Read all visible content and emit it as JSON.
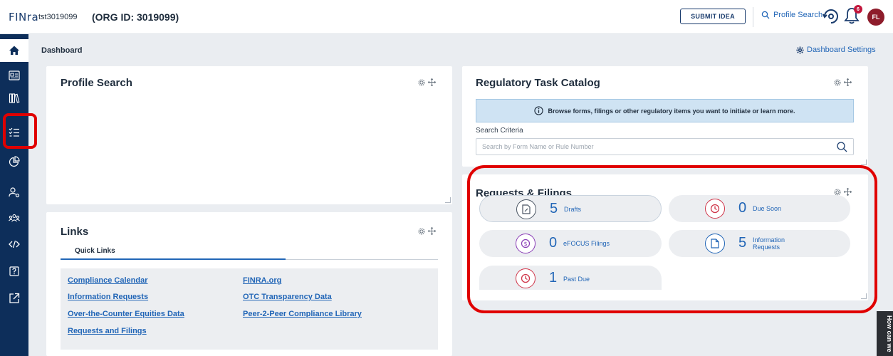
{
  "header": {
    "brand": "FINra",
    "user_id": "tst3019099",
    "org_label": "(ORG ID: 3019099)",
    "submit_idea_label": "SUBMIT IDEA",
    "profile_search_label": "Profile Search",
    "notification_count": "6",
    "avatar_initials": "FL"
  },
  "sidebar": {
    "items": [
      {
        "icon": "home-icon",
        "active": true
      },
      {
        "icon": "id-card-icon"
      },
      {
        "icon": "library-icon"
      },
      {
        "icon": "checklist-icon",
        "highlighted": true
      },
      {
        "icon": "pie-chart-icon"
      },
      {
        "icon": "user-settings-icon"
      },
      {
        "icon": "group-icon"
      },
      {
        "icon": "code-icon"
      },
      {
        "icon": "help-icon"
      },
      {
        "icon": "external-link-icon"
      }
    ]
  },
  "dashboard": {
    "title": "Dashboard",
    "settings_label": "Dashboard Settings"
  },
  "profile_search_panel": {
    "title": "Profile Search"
  },
  "links_panel": {
    "title": "Links",
    "tab_label": "Quick Links",
    "links": [
      "Compliance Calendar",
      "Information Requests",
      "Over-the-Counter Equities Data",
      "Requests and Filings",
      "FINRA.org",
      "OTC Transparency Data",
      "Peer-2-Peer Compliance Library"
    ]
  },
  "task_catalog": {
    "title": "Regulatory Task Catalog",
    "info_text": "Browse forms, filings or other regulatory items you want to initiate or learn more.",
    "search_label": "Search Criteria",
    "search_placeholder": "Search by Form Name or Rule Number"
  },
  "requests_filings": {
    "title": "Requests & Filings",
    "tiles": [
      {
        "count": "5",
        "label": "Drafts",
        "icon": "draft-document-icon",
        "color": "#4a5563"
      },
      {
        "count": "0",
        "label": "Due Soon",
        "icon": "clock-icon",
        "color": "#d0364a"
      },
      {
        "count": "0",
        "label": "eFOCUS Filings",
        "icon": "dollar-icon",
        "color": "#8a3db6"
      },
      {
        "count": "5",
        "label_line1": "Information",
        "label_line2": "Requests",
        "icon": "document-icon",
        "color": "#2266b7"
      },
      {
        "count": "1",
        "label": "Past Due",
        "icon": "clock-icon",
        "color": "#d0364a"
      }
    ]
  },
  "feedback_tab": {
    "label": "How can we"
  },
  "colors": {
    "sidebar_bg": "#0d2e5a",
    "accent": "#2266b7",
    "highlight_annotation": "#e00000",
    "info_bg": "#cfe3f3"
  }
}
